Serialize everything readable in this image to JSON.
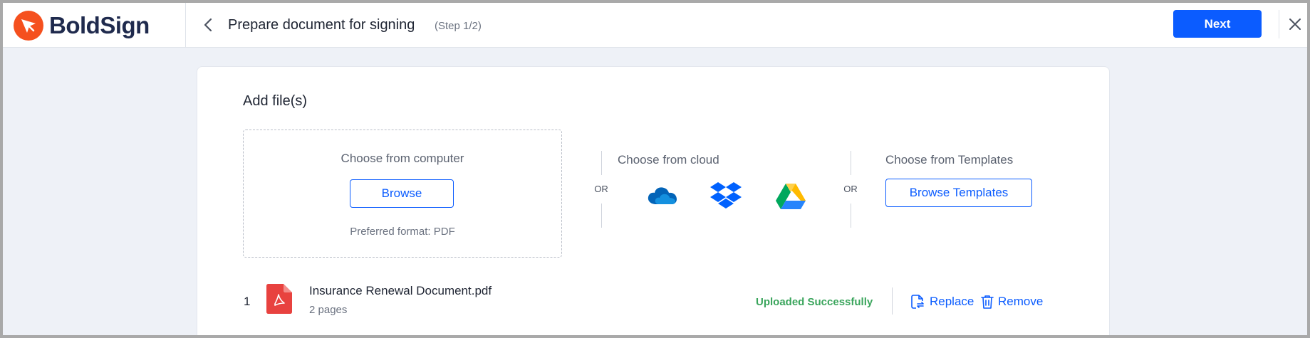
{
  "header": {
    "brand": "BoldSign",
    "title": "Prepare document for signing",
    "step": "(Step 1/2)",
    "next_label": "Next"
  },
  "add_files": {
    "title": "Add file(s)",
    "computer": {
      "title": "Choose from computer",
      "browse_label": "Browse",
      "hint": "Preferred format: PDF"
    },
    "or_label": "OR",
    "cloud": {
      "title": "Choose from cloud",
      "providers": [
        "onedrive-icon",
        "dropbox-icon",
        "google-drive-icon"
      ]
    },
    "templates": {
      "title": "Choose from Templates",
      "browse_label": "Browse Templates"
    }
  },
  "files": [
    {
      "index": "1",
      "name": "Insurance Renewal Document.pdf",
      "pages": "2 pages",
      "status": "Uploaded Successfully",
      "replace_label": "Replace",
      "remove_label": "Remove"
    }
  ],
  "colors": {
    "accent": "#0b5cff",
    "brand": "#f5501e",
    "success": "#3aa55c",
    "pdf": "#e8423f"
  }
}
